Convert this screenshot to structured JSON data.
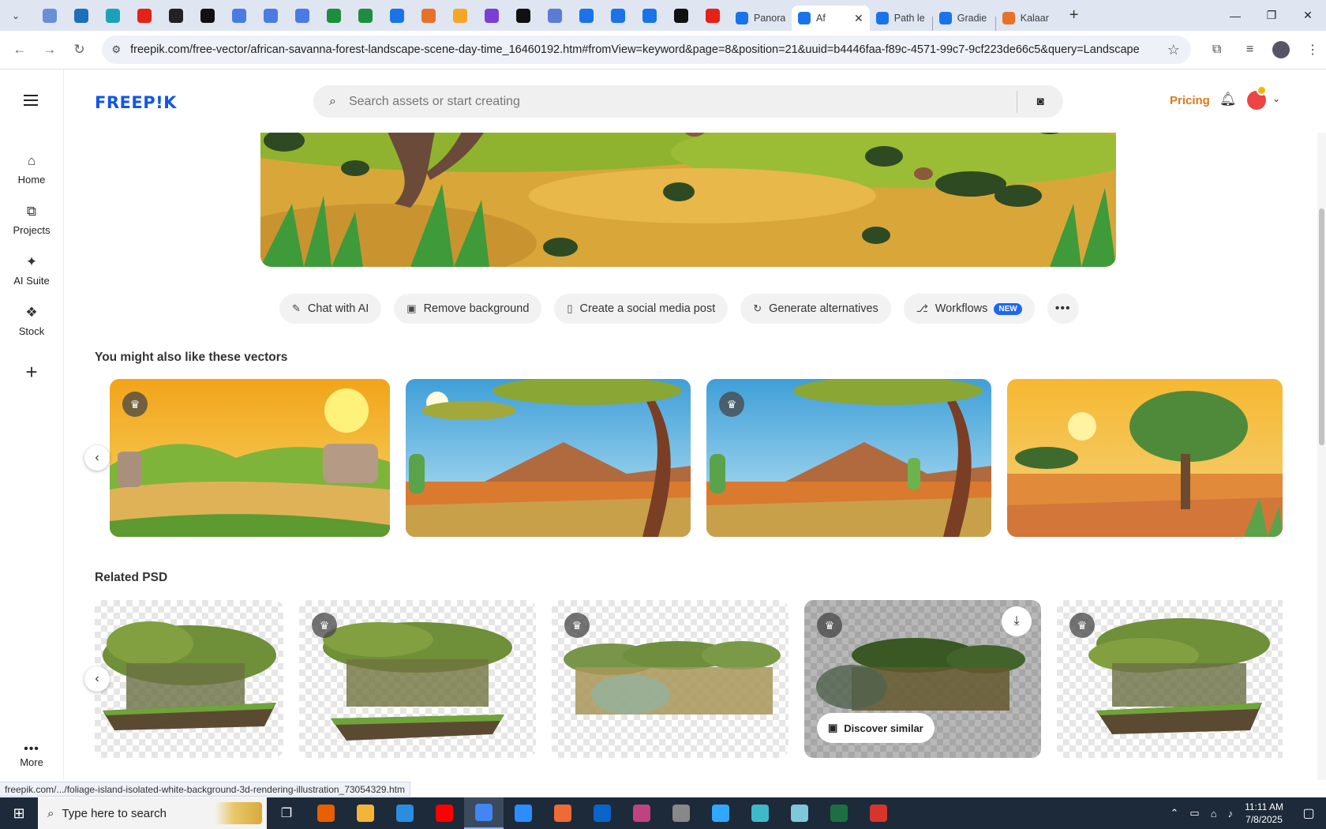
{
  "browser": {
    "tabs": [
      {
        "label": "Panora",
        "color": "#1a73e8"
      },
      {
        "label": "Af",
        "color": "#1a73e8",
        "active": true
      },
      {
        "label": "Path le",
        "color": "#1a73e8"
      },
      {
        "label": "Gradie",
        "color": "#1a73e8"
      },
      {
        "label": "Kalaar",
        "color": "#e8712a"
      }
    ],
    "pinned_favicons": [
      "#6a8fd6",
      "#1d6fb8",
      "#1aa3b8",
      "#e62117",
      "#222222",
      "#111111",
      "#4a7be5",
      "#4a7be5",
      "#4a7be5",
      "#1e8e3e",
      "#1e8e3e",
      "#1a73e8",
      "#e8712a",
      "#f5a623",
      "#7b3fd6",
      "#111111",
      "#5b7bd5",
      "#1a73e8",
      "#1a73e8",
      "#1a73e8",
      "#111111",
      "#e62117"
    ],
    "url": "freepik.com/free-vector/african-savanna-forest-landscape-scene-day-time_16460192.htm#fromView=keyword&page=8&position=21&uuid=b4446faa-f89c-4571-99c7-9cf223de66c5&query=Landscape",
    "status_url": "freepik.com/.../foliage-island-isolated-white-background-3d-rendering-illustration_73054329.htm"
  },
  "sidebar": {
    "items": [
      {
        "label": "Home",
        "icon": "home-icon"
      },
      {
        "label": "Projects",
        "icon": "projects-icon"
      },
      {
        "label": "AI Suite",
        "icon": "ai-sparkle-icon"
      },
      {
        "label": "Stock",
        "icon": "stock-icon"
      }
    ],
    "more_label": "More"
  },
  "header": {
    "logo": "FREEP!K",
    "search_placeholder": "Search assets or start creating",
    "pricing": "Pricing"
  },
  "actions": {
    "chat": "Chat with AI",
    "remove_bg": "Remove background",
    "social": "Create a social media post",
    "alternatives": "Generate alternatives",
    "workflows": "Workflows",
    "new_badge": "NEW"
  },
  "sections": {
    "vectors_title": "You might also like these vectors",
    "psd_title": "Related PSD"
  },
  "psd_card": {
    "discover": "Discover similar"
  },
  "taskbar": {
    "search_placeholder": "Type here to search",
    "time": "11:11 AM",
    "date": "7/8/2025",
    "apps": [
      "#e66000",
      "#f2b53a",
      "#2b8ce0",
      "#ff0000",
      "#4285f4",
      "#2d8cff",
      "#f06a35",
      "#0a64c9",
      "#c0437f",
      "#888888",
      "#31a8ff",
      "#3fb9c9",
      "#7fc7d9",
      "#1d6f42",
      "#d9342b"
    ]
  },
  "colors": {
    "brand": "#1356e6",
    "pricing": "#e2771b",
    "new_badge": "#1e67f0"
  }
}
